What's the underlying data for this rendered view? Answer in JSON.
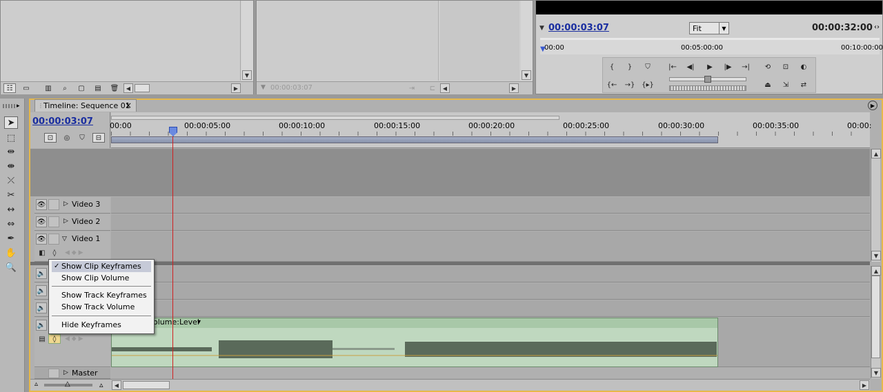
{
  "monitor": {
    "current_time": "00:00:03:07",
    "zoom": "Fit",
    "duration": "00:00:32:00",
    "ruler_labels": [
      "00:00",
      "00:05:00:00",
      "00:10:00:00"
    ]
  },
  "source_monitor": {
    "timecode": "00:00:03:07"
  },
  "timeline": {
    "tab_label": "Timeline: Sequence 01",
    "close_glyph": "×",
    "current_time": "00:00:03:07",
    "ruler_labels": [
      "00:00",
      "00:00:05:00",
      "00:00:10:00",
      "00:00:15:00",
      "00:00:20:00",
      "00:00:25:00",
      "00:00:30:00",
      "00:00:35:00",
      "00:00:"
    ],
    "tracks": {
      "video3": "Video 3",
      "video2": "Video 2",
      "video1": "Video 1",
      "master": "Master"
    },
    "clip_label": "olume:Level",
    "clip_dropdown": "▾"
  },
  "context_menu": {
    "items": [
      {
        "label": "Show Clip Keyframes",
        "checked": true
      },
      {
        "label": "Show Clip Volume",
        "checked": false
      },
      {
        "label": "Show Track Keyframes",
        "checked": false
      },
      {
        "label": "Show Track Volume",
        "checked": false
      },
      {
        "label": "Hide Keyframes",
        "checked": false
      }
    ],
    "check_glyph": "✓"
  },
  "colors": {
    "accent_timecode": "#1a2ea0",
    "panel_highlight": "#e6b84a",
    "playhead": "#d02020",
    "clip_fill": "#bfd8bf",
    "waveform": "#5a6a5a"
  }
}
